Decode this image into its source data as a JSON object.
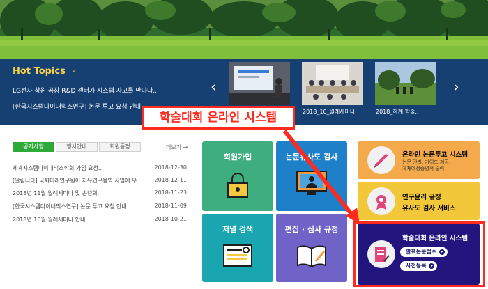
{
  "colors": {
    "hot_band": "#163f72",
    "hot_title": "#f5d24a",
    "tab_active": "#2eaa3a",
    "tile_green": "#3fae7f",
    "tile_blue": "#1d80c9",
    "tile_teal": "#1aa6b0",
    "tile_purple": "#6f63c7",
    "card_orange": "#f4a94a",
    "card_yellow": "#f2c73a",
    "card_navy": "#22167e",
    "callout_red": "#ff2b1f"
  },
  "hot_topics": {
    "title": "Hot Topics",
    "caret": "⌄",
    "lines": [
      "LG전자 창원 공장 R&D 센터가 시스템 사고를 만나다...",
      "[한국시스템다이내믹스연구] 논문 투고 요청 안내..."
    ],
    "prev_icon": "chevron-left-icon",
    "next_icon": "chevron-right-icon",
    "thumbnails": [
      {
        "caption": ""
      },
      {
        "caption": "2018_10_월례세미나"
      },
      {
        "caption": "2018_하계 학술.."
      }
    ]
  },
  "notice": {
    "tabs": [
      "공지사항",
      "행사안내",
      "회원동정"
    ],
    "more": "더보기 →",
    "rows": [
      {
        "title": "세계시스템다이내믹스학회 가입 요청..",
        "date": "2018-12-30"
      },
      {
        "title": "[알림니다] 국회미래연구원이 자유연구용역 사업에 우...",
        "date": "2018-12-11"
      },
      {
        "title": "2018년 11월 월례세미나 및 송년회..",
        "date": "2018-11-23"
      },
      {
        "title": "[한국시스템다이내믹스연구] 논문 투고 요청 안내..",
        "date": "2018-11-09"
      },
      {
        "title": "2018년 10월 월례세미나 안내..",
        "date": "2018-10-21"
      }
    ]
  },
  "tiles": {
    "join": "회원가입",
    "similarity": "논문유사도 검사",
    "journal_search": "저널 검색",
    "review": "편집 · 심사 규정"
  },
  "cards": {
    "submission": {
      "title": "온라인 논문투고 시스템",
      "sub": "논문 관리, 가이드 제공,\n게재예정증명서 출력"
    },
    "ethics": {
      "title": "연구윤리 규정",
      "sub": "유사도 검사 서비스"
    },
    "conference": {
      "title": "학술대회 온라인 시스템",
      "pill1": "발표논문접수",
      "pill2": "사전등록",
      "pill_arrow": "▸"
    }
  },
  "callout": "학술대회 온라인 시스템"
}
